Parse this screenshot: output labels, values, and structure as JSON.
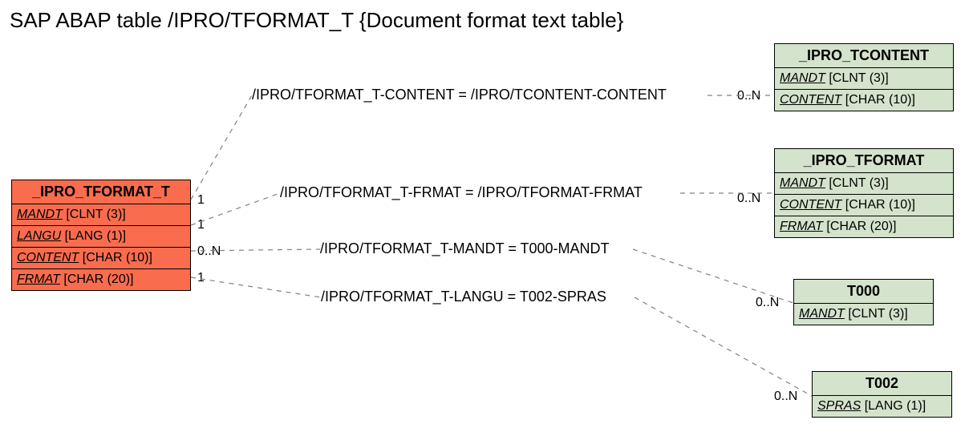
{
  "title": "SAP ABAP table /IPRO/TFORMAT_T {Document format text table}",
  "source_entity": {
    "name": "_IPRO_TFORMAT_T",
    "fields": [
      {
        "field": "MANDT",
        "type": "[CLNT (3)]"
      },
      {
        "field": "LANGU",
        "type": "[LANG (1)]"
      },
      {
        "field": "CONTENT",
        "type": "[CHAR (10)]"
      },
      {
        "field": "FRMAT",
        "type": "[CHAR (20)]"
      }
    ]
  },
  "target_entities": [
    {
      "name": "_IPRO_TCONTENT",
      "fields": [
        {
          "field": "MANDT",
          "type": "[CLNT (3)]"
        },
        {
          "field": "CONTENT",
          "type": "[CHAR (10)]"
        }
      ]
    },
    {
      "name": "_IPRO_TFORMAT",
      "fields": [
        {
          "field": "MANDT",
          "type": "[CLNT (3)]"
        },
        {
          "field": "CONTENT",
          "type": "[CHAR (10)]"
        },
        {
          "field": "FRMAT",
          "type": "[CHAR (20)]"
        }
      ]
    },
    {
      "name": "T000",
      "fields": [
        {
          "field": "MANDT",
          "type": "[CLNT (3)]"
        }
      ]
    },
    {
      "name": "T002",
      "fields": [
        {
          "field": "SPRAS",
          "type": "[LANG (1)]"
        }
      ]
    }
  ],
  "relations": [
    {
      "label": "/IPRO/TFORMAT_T-CONTENT = /IPRO/TCONTENT-CONTENT",
      "src_card": "1",
      "tgt_card": "0..N"
    },
    {
      "label": "/IPRO/TFORMAT_T-FRMAT = /IPRO/TFORMAT-FRMAT",
      "src_card": "1",
      "tgt_card": "0..N"
    },
    {
      "label": "/IPRO/TFORMAT_T-MANDT = T000-MANDT",
      "src_card": "0..N",
      "tgt_card": "0..N"
    },
    {
      "label": "/IPRO/TFORMAT_T-LANGU = T002-SPRAS",
      "src_card": "1",
      "tgt_card": "0..N"
    }
  ]
}
